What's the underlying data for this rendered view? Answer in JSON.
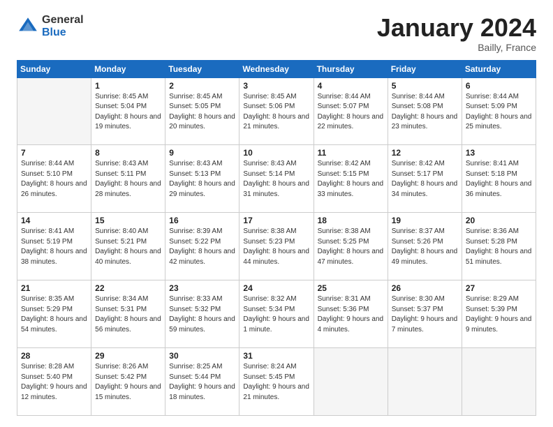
{
  "header": {
    "logo_general": "General",
    "logo_blue": "Blue",
    "title": "January 2024",
    "subtitle": "Bailly, France"
  },
  "weekdays": [
    "Sunday",
    "Monday",
    "Tuesday",
    "Wednesday",
    "Thursday",
    "Friday",
    "Saturday"
  ],
  "weeks": [
    [
      {
        "day": "",
        "info": ""
      },
      {
        "day": "1",
        "info": "Sunrise: 8:45 AM\nSunset: 5:04 PM\nDaylight: 8 hours\nand 19 minutes."
      },
      {
        "day": "2",
        "info": "Sunrise: 8:45 AM\nSunset: 5:05 PM\nDaylight: 8 hours\nand 20 minutes."
      },
      {
        "day": "3",
        "info": "Sunrise: 8:45 AM\nSunset: 5:06 PM\nDaylight: 8 hours\nand 21 minutes."
      },
      {
        "day": "4",
        "info": "Sunrise: 8:44 AM\nSunset: 5:07 PM\nDaylight: 8 hours\nand 22 minutes."
      },
      {
        "day": "5",
        "info": "Sunrise: 8:44 AM\nSunset: 5:08 PM\nDaylight: 8 hours\nand 23 minutes."
      },
      {
        "day": "6",
        "info": "Sunrise: 8:44 AM\nSunset: 5:09 PM\nDaylight: 8 hours\nand 25 minutes."
      }
    ],
    [
      {
        "day": "7",
        "info": "Sunrise: 8:44 AM\nSunset: 5:10 PM\nDaylight: 8 hours\nand 26 minutes."
      },
      {
        "day": "8",
        "info": "Sunrise: 8:43 AM\nSunset: 5:11 PM\nDaylight: 8 hours\nand 28 minutes."
      },
      {
        "day": "9",
        "info": "Sunrise: 8:43 AM\nSunset: 5:13 PM\nDaylight: 8 hours\nand 29 minutes."
      },
      {
        "day": "10",
        "info": "Sunrise: 8:43 AM\nSunset: 5:14 PM\nDaylight: 8 hours\nand 31 minutes."
      },
      {
        "day": "11",
        "info": "Sunrise: 8:42 AM\nSunset: 5:15 PM\nDaylight: 8 hours\nand 33 minutes."
      },
      {
        "day": "12",
        "info": "Sunrise: 8:42 AM\nSunset: 5:17 PM\nDaylight: 8 hours\nand 34 minutes."
      },
      {
        "day": "13",
        "info": "Sunrise: 8:41 AM\nSunset: 5:18 PM\nDaylight: 8 hours\nand 36 minutes."
      }
    ],
    [
      {
        "day": "14",
        "info": "Sunrise: 8:41 AM\nSunset: 5:19 PM\nDaylight: 8 hours\nand 38 minutes."
      },
      {
        "day": "15",
        "info": "Sunrise: 8:40 AM\nSunset: 5:21 PM\nDaylight: 8 hours\nand 40 minutes."
      },
      {
        "day": "16",
        "info": "Sunrise: 8:39 AM\nSunset: 5:22 PM\nDaylight: 8 hours\nand 42 minutes."
      },
      {
        "day": "17",
        "info": "Sunrise: 8:38 AM\nSunset: 5:23 PM\nDaylight: 8 hours\nand 44 minutes."
      },
      {
        "day": "18",
        "info": "Sunrise: 8:38 AM\nSunset: 5:25 PM\nDaylight: 8 hours\nand 47 minutes."
      },
      {
        "day": "19",
        "info": "Sunrise: 8:37 AM\nSunset: 5:26 PM\nDaylight: 8 hours\nand 49 minutes."
      },
      {
        "day": "20",
        "info": "Sunrise: 8:36 AM\nSunset: 5:28 PM\nDaylight: 8 hours\nand 51 minutes."
      }
    ],
    [
      {
        "day": "21",
        "info": "Sunrise: 8:35 AM\nSunset: 5:29 PM\nDaylight: 8 hours\nand 54 minutes."
      },
      {
        "day": "22",
        "info": "Sunrise: 8:34 AM\nSunset: 5:31 PM\nDaylight: 8 hours\nand 56 minutes."
      },
      {
        "day": "23",
        "info": "Sunrise: 8:33 AM\nSunset: 5:32 PM\nDaylight: 8 hours\nand 59 minutes."
      },
      {
        "day": "24",
        "info": "Sunrise: 8:32 AM\nSunset: 5:34 PM\nDaylight: 9 hours\nand 1 minute."
      },
      {
        "day": "25",
        "info": "Sunrise: 8:31 AM\nSunset: 5:36 PM\nDaylight: 9 hours\nand 4 minutes."
      },
      {
        "day": "26",
        "info": "Sunrise: 8:30 AM\nSunset: 5:37 PM\nDaylight: 9 hours\nand 7 minutes."
      },
      {
        "day": "27",
        "info": "Sunrise: 8:29 AM\nSunset: 5:39 PM\nDaylight: 9 hours\nand 9 minutes."
      }
    ],
    [
      {
        "day": "28",
        "info": "Sunrise: 8:28 AM\nSunset: 5:40 PM\nDaylight: 9 hours\nand 12 minutes."
      },
      {
        "day": "29",
        "info": "Sunrise: 8:26 AM\nSunset: 5:42 PM\nDaylight: 9 hours\nand 15 minutes."
      },
      {
        "day": "30",
        "info": "Sunrise: 8:25 AM\nSunset: 5:44 PM\nDaylight: 9 hours\nand 18 minutes."
      },
      {
        "day": "31",
        "info": "Sunrise: 8:24 AM\nSunset: 5:45 PM\nDaylight: 9 hours\nand 21 minutes."
      },
      {
        "day": "",
        "info": ""
      },
      {
        "day": "",
        "info": ""
      },
      {
        "day": "",
        "info": ""
      }
    ]
  ]
}
